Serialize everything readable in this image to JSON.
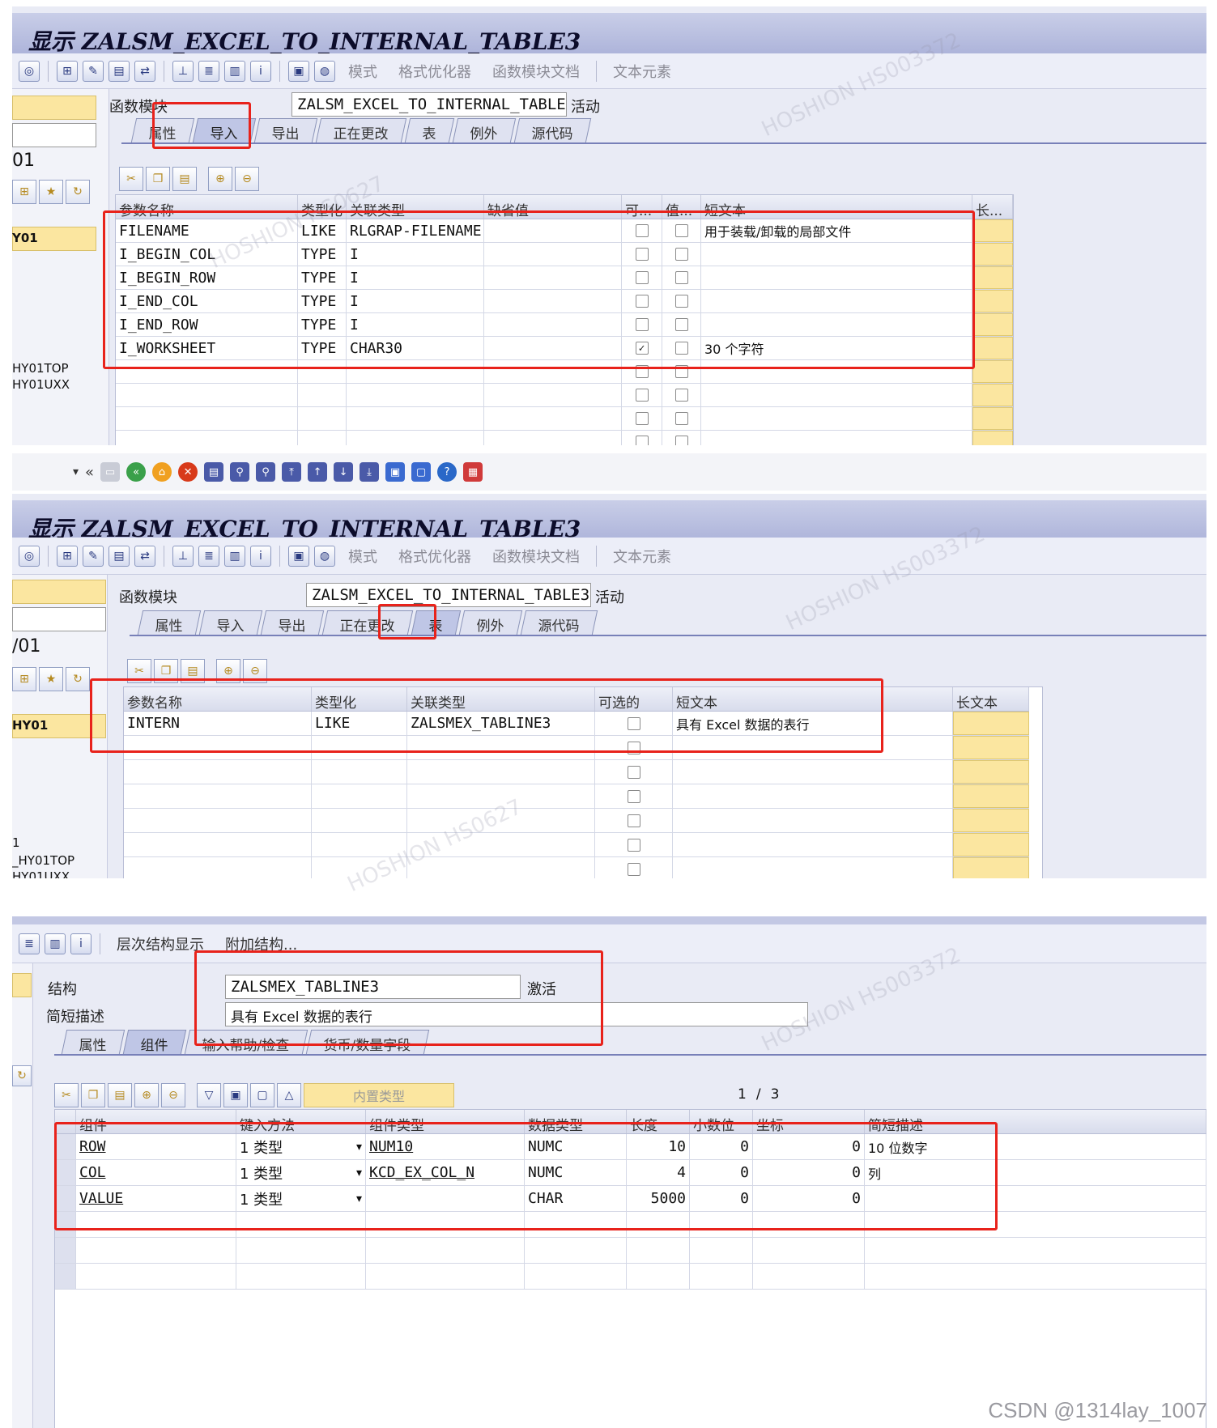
{
  "panel1": {
    "title": "显示 ZALSM_EXCEL_TO_INTERNAL_TABLE3",
    "toolbar_texts": [
      "模式",
      "格式优化器",
      "函数模块文档",
      "文本元素"
    ],
    "func_label": "函数模块",
    "func_value": "ZALSM_EXCEL_TO_INTERNAL_TABLE3",
    "status": "活动",
    "tabs": [
      "属性",
      "导入",
      "导出",
      "正在更改",
      "表",
      "例外",
      "源代码"
    ],
    "active_tab": "导入",
    "left": {
      "field": "01",
      "item": "Y01",
      "list": [
        "HY01TOP",
        "HY01UXX"
      ]
    },
    "columns": [
      "参数名称",
      "类型化",
      "关联类型",
      "缺省值",
      "可...",
      "值...",
      "短文本",
      "长..."
    ],
    "rows": [
      {
        "name": "FILENAME",
        "typing": "LIKE",
        "ref": "RLGRAP-FILENAME",
        "default": "",
        "optional": false,
        "value": false,
        "text": "用于装载/卸载的局部文件"
      },
      {
        "name": "I_BEGIN_COL",
        "typing": "TYPE",
        "ref": "I",
        "default": "",
        "optional": false,
        "value": false,
        "text": ""
      },
      {
        "name": "I_BEGIN_ROW",
        "typing": "TYPE",
        "ref": "I",
        "default": "",
        "optional": false,
        "value": false,
        "text": ""
      },
      {
        "name": "I_END_COL",
        "typing": "TYPE",
        "ref": "I",
        "default": "",
        "optional": false,
        "value": false,
        "text": ""
      },
      {
        "name": "I_END_ROW",
        "typing": "TYPE",
        "ref": "I",
        "default": "",
        "optional": false,
        "value": false,
        "text": ""
      },
      {
        "name": "I_WORKSHEET",
        "typing": "TYPE",
        "ref": "CHAR30",
        "default": "",
        "optional": true,
        "value": false,
        "text": "30 个字符"
      }
    ]
  },
  "panel2": {
    "title": "显示 ZALSM_EXCEL_TO_INTERNAL_TABLE3",
    "toolbar_texts": [
      "模式",
      "格式优化器",
      "函数模块文档",
      "文本元素"
    ],
    "func_label": "函数模块",
    "func_value": "ZALSM_EXCEL_TO_INTERNAL_TABLE3",
    "status": "活动",
    "tabs": [
      "属性",
      "导入",
      "导出",
      "正在更改",
      "表",
      "例外",
      "源代码"
    ],
    "active_tab": "表",
    "left": {
      "field": "/01",
      "item": "HY01",
      "list": [
        "1",
        "_HY01TOP",
        "HY01UXX"
      ]
    },
    "columns": [
      "参数名称",
      "类型化",
      "关联类型",
      "可选的",
      "短文本",
      "长文本"
    ],
    "rows": [
      {
        "name": "INTERN",
        "typing": "LIKE",
        "ref": "ZALSMEX_TABLINE3",
        "optional": false,
        "text": "具有 Excel 数据的表行"
      }
    ]
  },
  "panel3": {
    "toolbar_texts": [
      "层次结构显示",
      "附加结构..."
    ],
    "struct_label": "结构",
    "struct_value": "ZALSMEX_TABLINE3",
    "struct_status": "激活",
    "desc_label": "简短描述",
    "desc_value": "具有 Excel 数据的表行",
    "tabs": [
      "属性",
      "组件",
      "输入帮助/检查",
      "货币/数量字段"
    ],
    "active_tab": "组件",
    "builtin_label": "内置类型",
    "page_current": "1",
    "page_sep": "/",
    "page_total": "3",
    "columns": [
      "组件",
      "键入方法",
      "组件类型",
      "数据类型",
      "长度",
      "小数位",
      "坐标",
      "简短描述"
    ],
    "rows": [
      {
        "comp": "ROW",
        "method": "1  类型",
        "ctype": "NUM10",
        "dtype": "NUMC",
        "len": "10",
        "dec": "0",
        "coord": "0",
        "desc": "10 位数字"
      },
      {
        "comp": "COL",
        "method": "1  类型",
        "ctype": "KCD_EX_COL_N",
        "dtype": "NUMC",
        "len": "4",
        "dec": "0",
        "coord": "0",
        "desc": "列"
      },
      {
        "comp": "VALUE",
        "method": "1  类型",
        "ctype": "",
        "dtype": "CHAR",
        "len": "5000",
        "dec": "0",
        "coord": "0",
        "desc": ""
      }
    ]
  },
  "footer": "CSDN @1314lay_1007"
}
